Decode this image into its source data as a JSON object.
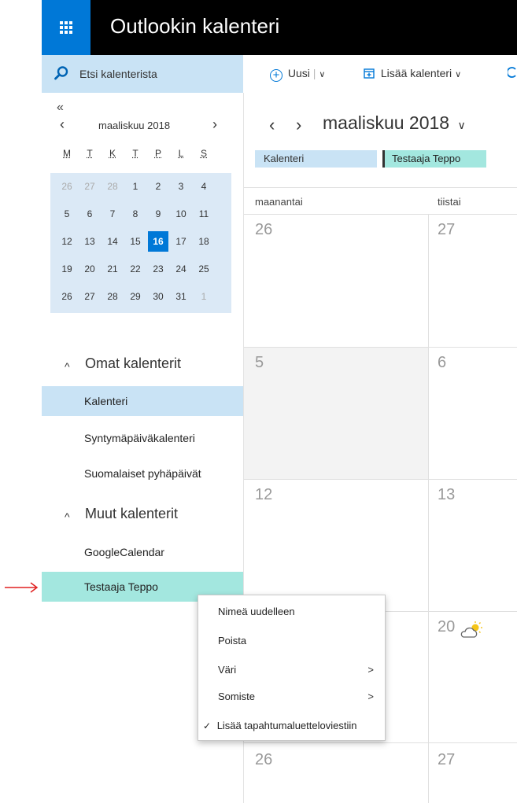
{
  "header": {
    "title": "Outlookin kalenteri"
  },
  "search": {
    "label": "Etsi kalenterista"
  },
  "mini_calendar": {
    "collapse": "«",
    "prev": "‹",
    "next": "›",
    "month": "maaliskuu 2018",
    "weekdays": [
      "M",
      "T",
      "K",
      "T",
      "P",
      "L",
      "S"
    ],
    "weeks": [
      [
        "26",
        "27",
        "28",
        "1",
        "2",
        "3",
        "4"
      ],
      [
        "5",
        "6",
        "7",
        "8",
        "9",
        "10",
        "11"
      ],
      [
        "12",
        "13",
        "14",
        "15",
        "16",
        "17",
        "18"
      ],
      [
        "19",
        "20",
        "21",
        "22",
        "23",
        "24",
        "25"
      ],
      [
        "26",
        "27",
        "28",
        "29",
        "30",
        "31",
        "1"
      ]
    ],
    "today": "16"
  },
  "sidebar": {
    "my_calendars_label": "Omat kalenterit",
    "my_calendars": [
      "Kalenteri",
      "Syntymäpäiväkalenteri",
      "Suomalaiset pyhäpäivät"
    ],
    "other_calendars_label": "Muut kalenterit",
    "other_calendars": [
      "GoogleCalendar",
      "Testaaja Teppo"
    ]
  },
  "toolbar": {
    "new_label": "Uusi",
    "add_calendar_label": "Lisää kalenteri"
  },
  "main": {
    "month_title": "maaliskuu 2018",
    "chips": [
      "Kalenteri",
      "Testaaja Teppo"
    ],
    "day_names": [
      "maanantai",
      "tiistai"
    ],
    "rows": [
      [
        "26",
        "27"
      ],
      [
        "5",
        "6"
      ],
      [
        "12",
        "13"
      ],
      [
        "",
        "20"
      ],
      [
        "26",
        "27"
      ]
    ]
  },
  "context_menu": {
    "items": [
      "Nimeä uudelleen",
      "Poista",
      "Väri",
      "Somiste",
      "Lisää tapahtumaluetteloviestiin"
    ]
  },
  "colors": {
    "accent": "#0078d7",
    "selected": "#c9e3f5",
    "teal_calendar": "#a3e7df",
    "header": "#000000",
    "arrow": "#e02020"
  }
}
